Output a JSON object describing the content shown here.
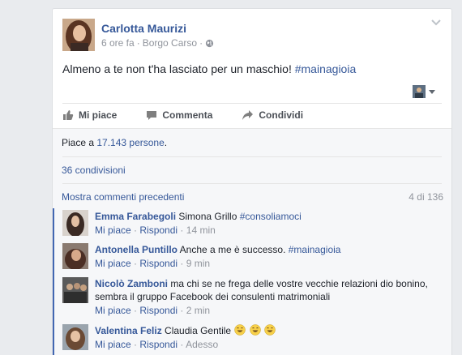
{
  "post": {
    "author": "Carlotta Maurizi",
    "time": "6 ore fa",
    "separator": "·",
    "location": "Borgo Carso",
    "text": "Almeno a te non t'ha lasciato per un maschio!",
    "hashtag": "#mainagioia"
  },
  "actions": {
    "like": "Mi piace",
    "comment": "Commenta",
    "share": "Condividi"
  },
  "summary": {
    "likes_prefix": "Piace a",
    "likes_count": "17.143 persone",
    "likes_suffix": ".",
    "shares": "36 condivisioni",
    "more_comments": "Mostra commenti precedenti",
    "pager": "4 di 136"
  },
  "comments": [
    {
      "name": "Emma Farabegoli",
      "text": "Simona Grillo",
      "tag": "#consoliamoci",
      "like": "Mi piace",
      "sep": "·",
      "reply": "Rispondi",
      "time": "14 min"
    },
    {
      "name": "Antonella Puntillo",
      "text": "Anche a me è successo.",
      "tag": "#mainagioia",
      "like": "Mi piace",
      "sep": "·",
      "reply": "Rispondi",
      "time": "9 min"
    },
    {
      "name": "Nicolò Zamboni",
      "text": "ma chi se ne frega delle vostre vecchie relazioni dio bonino, sembra il gruppo Facebook dei consulenti matrimoniali",
      "like": "Mi piace",
      "sep": "·",
      "reply": "Rispondi",
      "time": "2 min"
    },
    {
      "name": "Valentina Feliz",
      "text": "Claudia Gentile",
      "like": "Mi piace",
      "sep": "·",
      "reply": "Rispondi",
      "time": "Adesso"
    }
  ],
  "colors": {
    "link": "#365899",
    "meta": "#90949c",
    "accent_bar": "#4267b2"
  }
}
